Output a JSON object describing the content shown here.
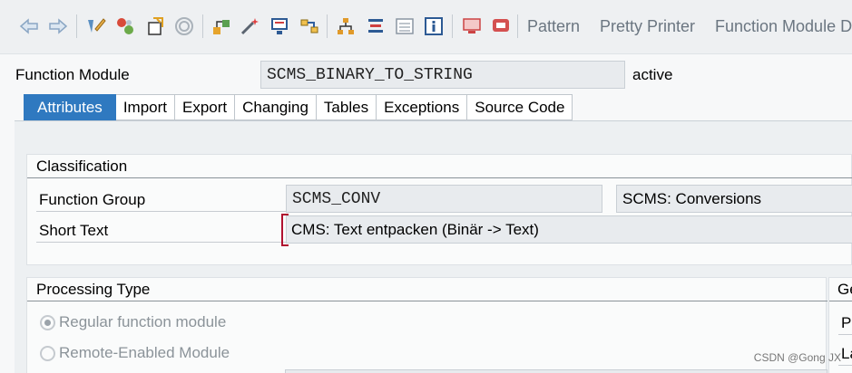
{
  "toolbar": {
    "icons": [
      "back-arrow-icon",
      "forward-arrow-icon",
      "display-change-icon",
      "other-object-icon",
      "activate-icon",
      "check-icon",
      "test-icon",
      "where-used-icon",
      "magic-wand-icon",
      "screen-icon",
      "network-icon",
      "hierarchy-icon",
      "stack-icon",
      "list-icon",
      "info-icon",
      "monitor-icon",
      "tools-icon"
    ],
    "pattern_label": "Pattern",
    "pretty_printer_label": "Pretty Printer",
    "function_module_doc_label": "Function Module Do"
  },
  "header": {
    "label": "Function Module",
    "value": "SCMS_BINARY_TO_STRING",
    "status": "active"
  },
  "tabs": [
    {
      "label": "Attributes",
      "active": true
    },
    {
      "label": "Import",
      "active": false
    },
    {
      "label": "Export",
      "active": false
    },
    {
      "label": "Changing",
      "active": false
    },
    {
      "label": "Tables",
      "active": false
    },
    {
      "label": "Exceptions",
      "active": false
    },
    {
      "label": "Source Code",
      "active": false
    }
  ],
  "classification": {
    "title": "Classification",
    "function_group_label": "Function Group",
    "function_group_value": "SCMS_CONV",
    "function_group_desc": "SCMS: Conversions",
    "short_text_label": "Short Text",
    "short_text_value": "CMS: Text entpacken (Binär -> Text)"
  },
  "processing_type": {
    "title": "Processing Type",
    "options": [
      {
        "label": "Regular function module",
        "selected": true
      },
      {
        "label": "Remote-Enabled Module",
        "selected": false
      }
    ]
  },
  "general": {
    "title": "Ge",
    "row1": "Pe",
    "row2": "La"
  },
  "watermark": "CSDN @Gong JX"
}
